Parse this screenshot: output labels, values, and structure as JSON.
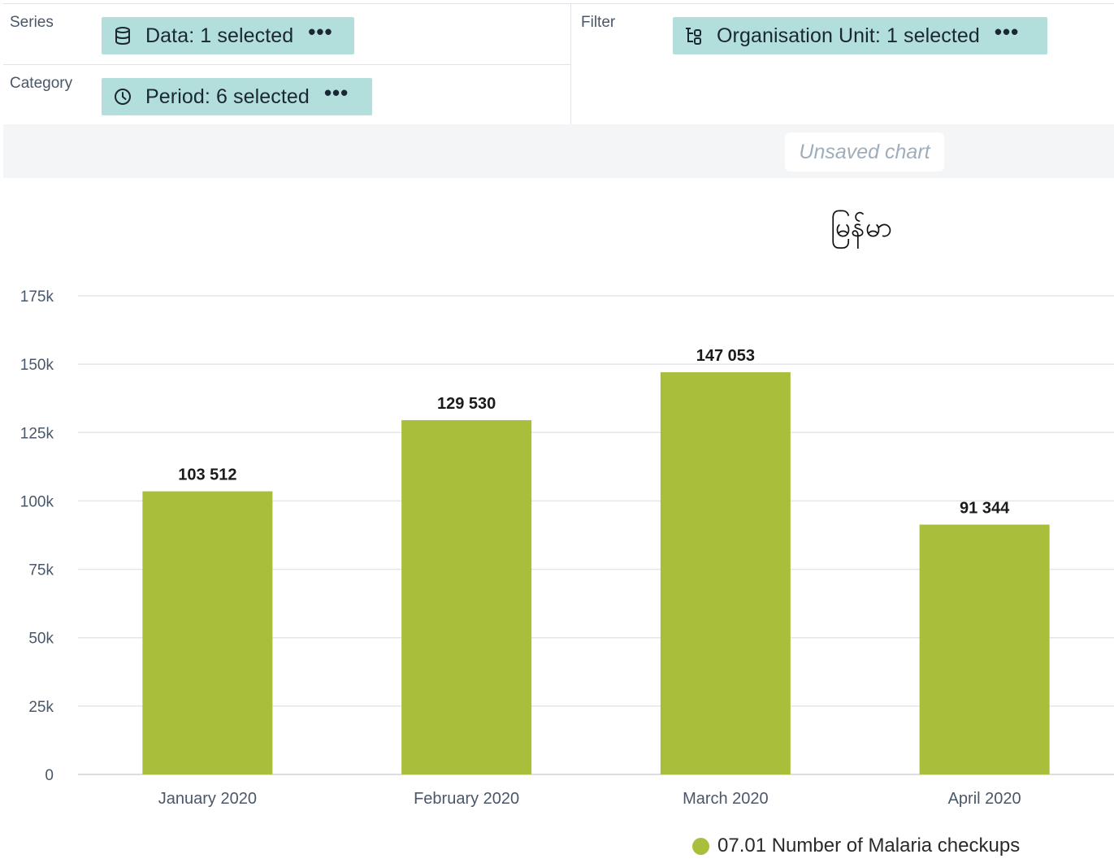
{
  "layout": {
    "series": {
      "label": "Series",
      "chip": {
        "icon": "database-icon",
        "label": "Data: 1 selected",
        "more": "•••"
      }
    },
    "category": {
      "label": "Category",
      "chip": {
        "icon": "clock-icon",
        "label": "Period: 6 selected",
        "more": "•••"
      }
    },
    "filter": {
      "label": "Filter",
      "chip": {
        "icon": "org-unit-tree-icon",
        "label": "Organisation Unit: 1 selected",
        "more": "•••"
      }
    }
  },
  "titlebar": {
    "status": "Unsaved chart"
  },
  "colors": {
    "chip_bg": "#b2dfdb",
    "bar": "#a9bf3c",
    "grid": "#e3e6ea",
    "axis_text": "#4a5768"
  },
  "chart_data": {
    "type": "bar",
    "title": "မြန်မာ",
    "categories": [
      "January 2020",
      "February 2020",
      "March 2020",
      "April 2020"
    ],
    "series": [
      {
        "name": "07.01 Number of Malaria checkups",
        "values": [
          103512,
          129530,
          147053,
          91344
        ],
        "value_labels": [
          "103 512",
          "129 530",
          "147 053",
          "91 344"
        ],
        "color": "#a9bf3c"
      }
    ],
    "ylim": [
      0,
      175000
    ],
    "yticks": [
      0,
      25000,
      50000,
      75000,
      100000,
      125000,
      150000,
      175000
    ],
    "ytick_labels": [
      "0",
      "25k",
      "50k",
      "75k",
      "100k",
      "125k",
      "150k",
      "175k"
    ],
    "grid": true,
    "legend": "bottom-right"
  }
}
